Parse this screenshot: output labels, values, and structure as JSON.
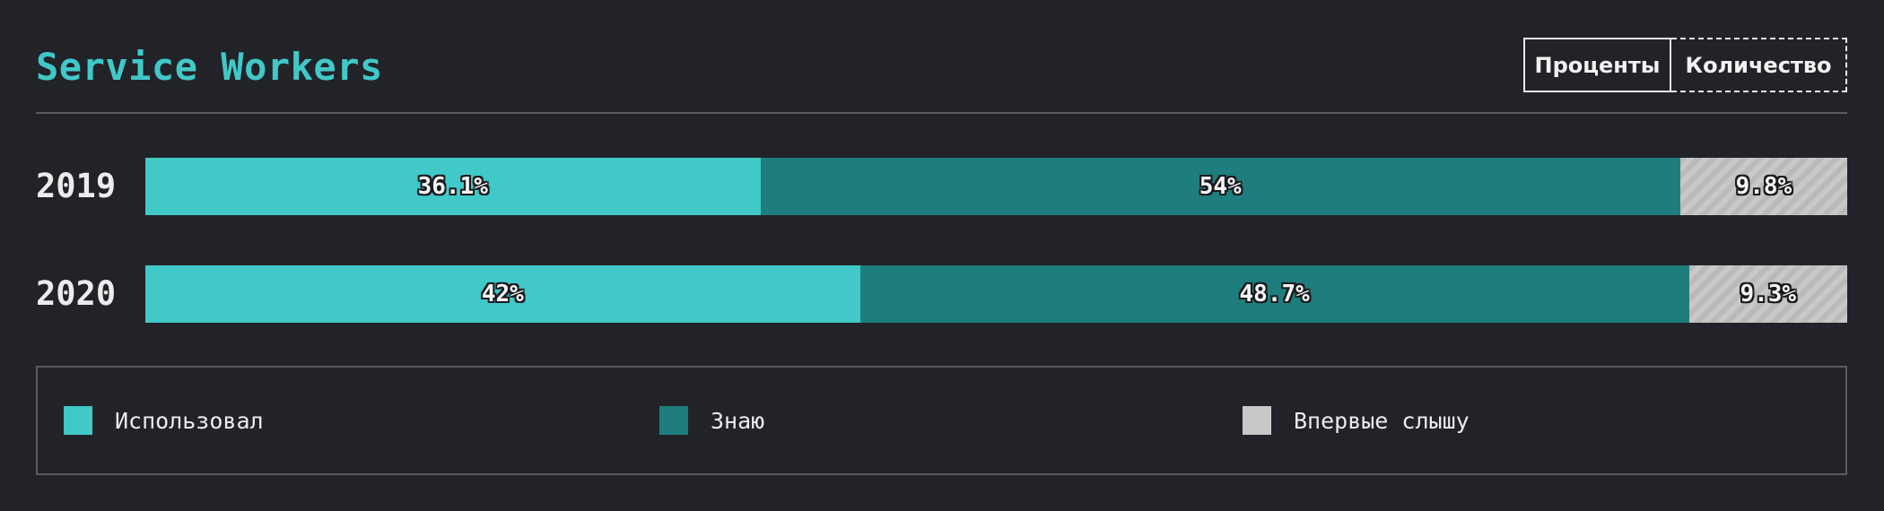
{
  "header": {
    "title": "Service Workers",
    "toggle": {
      "percent_label": "Проценты",
      "count_label": "Количество"
    }
  },
  "colors": {
    "used": "#41c8c8",
    "know": "#1e7d7d",
    "first_time": "#c8c8c8",
    "background": "#222328"
  },
  "chart_data": {
    "type": "bar",
    "stacked": true,
    "orientation": "horizontal",
    "title": "Service Workers",
    "categories": [
      "2019",
      "2020"
    ],
    "series": [
      {
        "name": "Использовал",
        "values": [
          36.1,
          42
        ],
        "labels": [
          "36.1%",
          "42%"
        ],
        "color": "#41c8c8"
      },
      {
        "name": "Знаю",
        "values": [
          54,
          48.7
        ],
        "labels": [
          "54%",
          "48.7%"
        ],
        "color": "#1e7d7d"
      },
      {
        "name": "Впервые слышу",
        "values": [
          9.8,
          9.3
        ],
        "labels": [
          "9.8%",
          "9.3%"
        ],
        "color": "#c8c8c8"
      }
    ],
    "unit": "%",
    "legend_position": "bottom"
  },
  "legend": {
    "items": [
      {
        "label": "Использовал",
        "color": "#41c8c8"
      },
      {
        "label": "Знаю",
        "color": "#1e7d7d"
      },
      {
        "label": "Впервые слышу",
        "color": "#c8c8c8"
      }
    ]
  }
}
